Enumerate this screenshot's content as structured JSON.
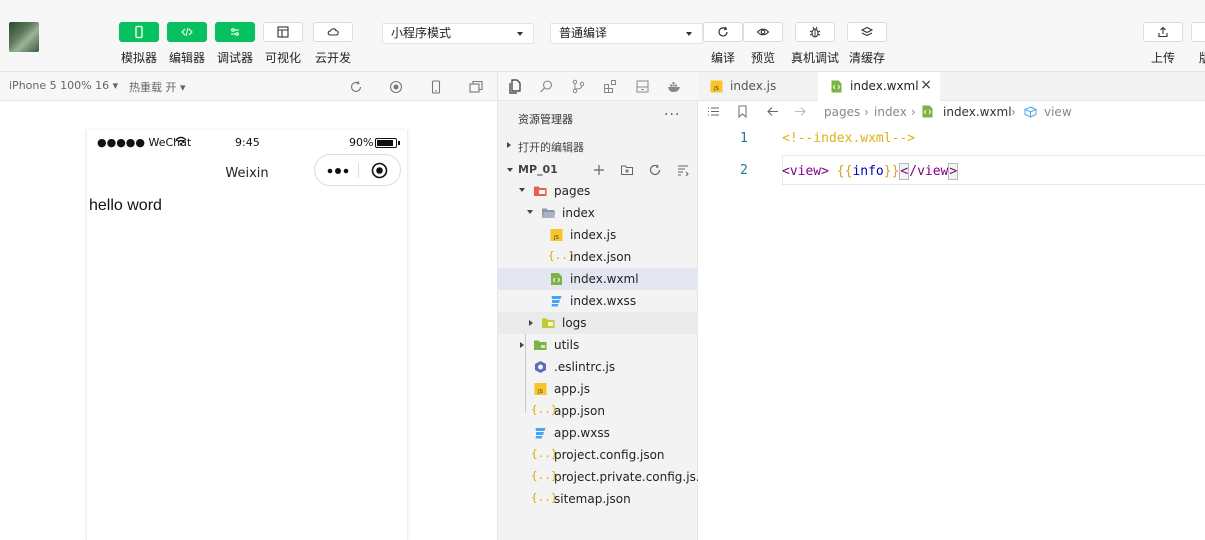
{
  "toolbar": {
    "simulator_label": "模拟器",
    "editor_label": "编辑器",
    "debugger_label": "调试器",
    "visual_label": "可视化",
    "cloud_label": "云开发",
    "mode_select": "小程序模式",
    "compile_select": "普通编译",
    "compile_label": "编译",
    "preview_label": "预览",
    "realdevice_label": "真机调试",
    "clearcache_label": "清缓存",
    "upload_label": "上传",
    "version_label": "版本"
  },
  "simulator": {
    "device_select": "iPhone 5 100% 16",
    "hot_reload": "热重载 开",
    "status_signal": "●●●●● WeChat",
    "status_time": "9:45",
    "status_battery": "90%",
    "nav_title": "Weixin",
    "page_text": "hello word"
  },
  "explorer": {
    "title": "资源管理器",
    "more": "···",
    "open_editors": "打开的编辑器",
    "project": "MP_01",
    "tree": [
      {
        "name": "pages",
        "kind": "folder-open-red"
      },
      {
        "name": "index",
        "kind": "folder-open-gray"
      },
      {
        "name": "index.js",
        "kind": "js"
      },
      {
        "name": "index.json",
        "kind": "json"
      },
      {
        "name": "index.wxml",
        "kind": "wxml"
      },
      {
        "name": "index.wxss",
        "kind": "wxss"
      },
      {
        "name": "logs",
        "kind": "folder"
      },
      {
        "name": "utils",
        "kind": "folder-green"
      },
      {
        "name": ".eslintrc.js",
        "kind": "eslint"
      },
      {
        "name": "app.js",
        "kind": "js"
      },
      {
        "name": "app.json",
        "kind": "json"
      },
      {
        "name": "app.wxss",
        "kind": "wxss"
      },
      {
        "name": "project.config.json",
        "kind": "json"
      },
      {
        "name": "project.private.config.js...",
        "kind": "json"
      },
      {
        "name": "sitemap.json",
        "kind": "json"
      }
    ]
  },
  "editor": {
    "tabs": [
      {
        "name": "index.js"
      },
      {
        "name": "index.wxml",
        "close": "×"
      }
    ],
    "breadcrumb": [
      "pages",
      "index",
      "index.wxml",
      "view"
    ],
    "line_numbers": [
      "1",
      "2"
    ],
    "line1": "<!--index.wxml-->",
    "line2_open": "<view>",
    "line2_brace_open": "{{",
    "line2_ident": "info",
    "line2_brace_close": "}}",
    "line2_close_a": "<",
    "line2_close_b": "/view",
    "line2_close_c": ">"
  },
  "colors": {
    "accent_green": "#07c160",
    "active_row": "#e4e6f1",
    "tag_purple": "#800080",
    "comment": "#e0b014"
  }
}
